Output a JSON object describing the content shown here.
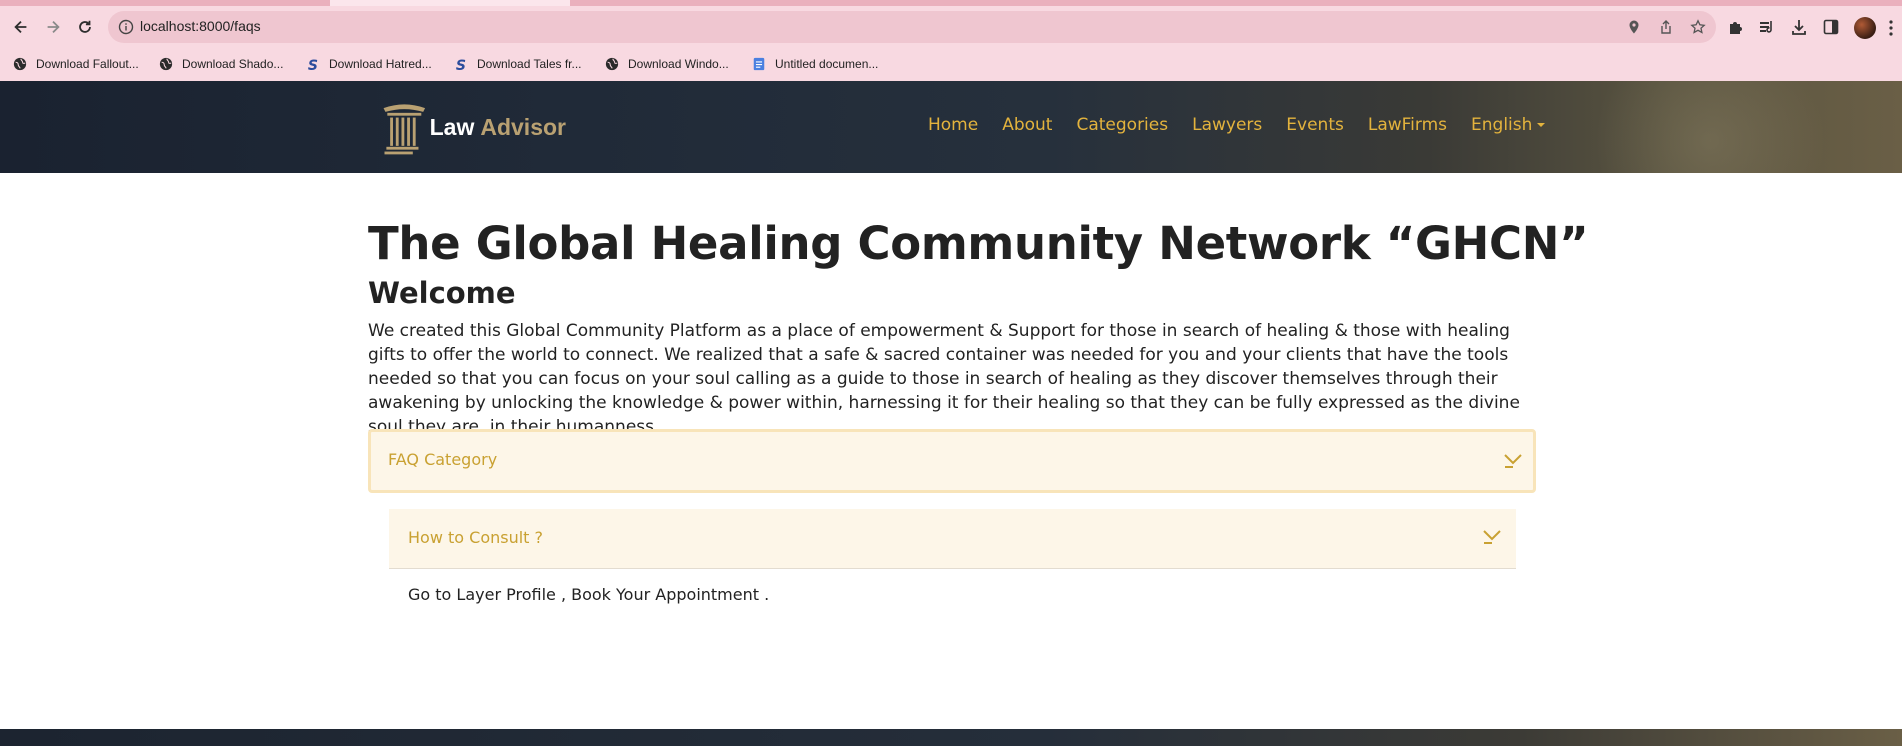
{
  "browser": {
    "url": "localhost:8000/faqs",
    "bookmarks": [
      {
        "label": "Download Fallout...",
        "icon": "globe-icon"
      },
      {
        "label": "Download Shado...",
        "icon": "globe-icon"
      },
      {
        "label": "Download Hatred...",
        "icon": "s-logo-icon"
      },
      {
        "label": "Download Tales fr...",
        "icon": "s-logo-icon"
      },
      {
        "label": "Download Windo...",
        "icon": "globe-icon"
      },
      {
        "label": "Untitled documen...",
        "icon": "docs-icon"
      }
    ]
  },
  "site": {
    "logo_word1": "Law",
    "logo_word2": "Advisor",
    "nav": [
      "Home",
      "About",
      "Categories",
      "Lawyers",
      "Events",
      "LawFirms"
    ],
    "language": "English",
    "accent_color": "#e3b33d"
  },
  "page": {
    "title": "The Global Healing Community Network “GHCN”",
    "subtitle": "Welcome",
    "intro": "We created this Global Community Platform as a place of empowerment & Support for those in search of healing & those with healing gifts to offer the world to connect. We realized that a safe & sacred container was needed for you and your clients that have the tools needed so that you can focus on your soul calling as a guide to those in search of healing as they discover themselves through their awakening by unlocking the knowledge & power within, harnessing it for their healing so that they can be fully expressed as the divine soul they are, in their humanness.",
    "faq_category": "FAQ Category",
    "faq_question": "How to Consult ?",
    "faq_answer": "Go to Layer Profile , Book Your Appointment ."
  }
}
